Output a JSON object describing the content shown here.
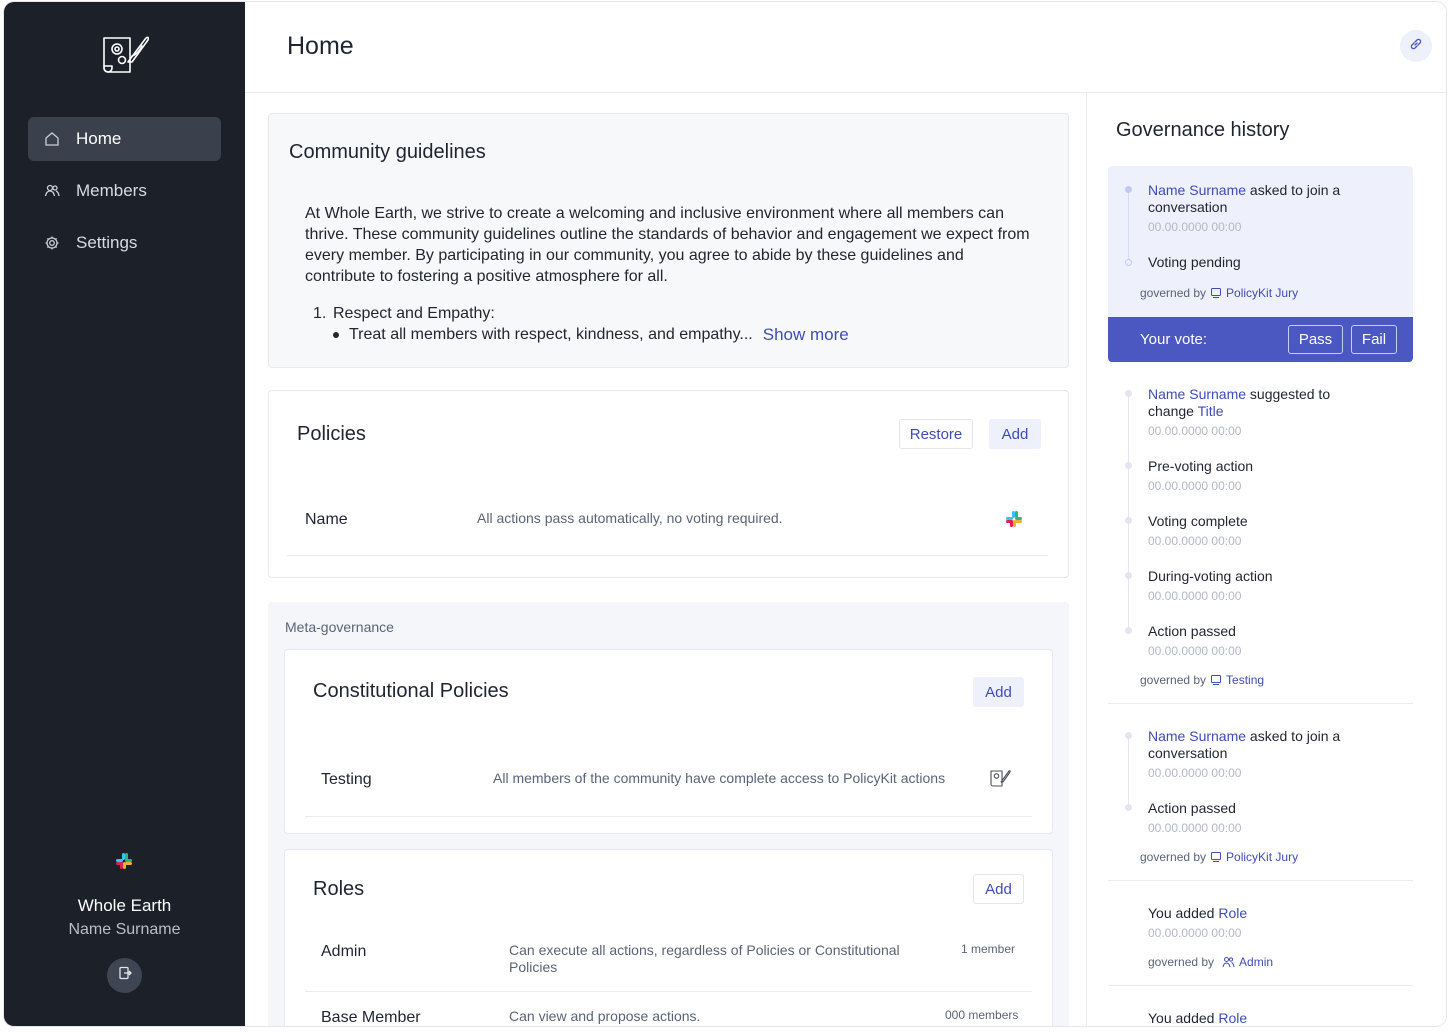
{
  "sidebar": {
    "nav": [
      {
        "label": "Home",
        "icon": "home-icon",
        "active": true
      },
      {
        "label": "Members",
        "icon": "members-icon",
        "active": false
      },
      {
        "label": "Settings",
        "icon": "gear-icon",
        "active": false
      }
    ],
    "org_name": "Whole Earth",
    "user_name": "Name Surname"
  },
  "header": {
    "title": "Home"
  },
  "guidelines": {
    "title": "Community guidelines",
    "body": "At Whole Earth, we strive to create a welcoming and inclusive environment where all members can thrive. These community guidelines outline the standards of behavior and engagement we expect from every member. By participating in our community, you agree to abide by these guidelines and contribute to fostering a positive atmosphere for all.",
    "list_number": "1.",
    "list_item": "Respect and Empathy:",
    "sub_item": "Treat all members with respect, kindness, and empathy...",
    "show_more": "Show more"
  },
  "policies": {
    "title": "Policies",
    "restore_label": "Restore",
    "add_label": "Add",
    "rows": [
      {
        "name": "Name",
        "description": "All actions pass automatically, no voting required.",
        "platform_icon": "slack-icon"
      }
    ]
  },
  "meta": {
    "label": "Meta-governance",
    "constitutional": {
      "title": "Constitutional Policies",
      "add_label": "Add",
      "rows": [
        {
          "name": "Testing",
          "description": "All members of the community have complete access to PolicyKit actions",
          "platform_icon": "policykit-icon"
        }
      ]
    },
    "roles": {
      "title": "Roles",
      "add_label": "Add",
      "rows": [
        {
          "name": "Admin",
          "description": "Can execute all actions, regardless of Policies or Constitutional Policies",
          "count": "1 member"
        },
        {
          "name": "Base Member",
          "description": "Can view and propose actions.",
          "count": "000 members"
        }
      ]
    }
  },
  "history": {
    "title": "Governance history",
    "pending": {
      "actor": "Name Surname",
      "action": " asked to join a conversation",
      "time": "00.00.0000  00:00",
      "status": "Voting pending",
      "governed_by_label": "governed by",
      "governed_by": "PolicyKit Jury",
      "vote_label": "Your vote:",
      "pass_label": "Pass",
      "fail_label": "Fail"
    },
    "second": {
      "actor": "Name Surname",
      "action": " suggested to change ",
      "target": "Title",
      "time": "00.00.0000  00:00",
      "steps": [
        {
          "label": "Pre-voting action",
          "time": "00.00.0000  00:00"
        },
        {
          "label": "Voting complete",
          "time": "00.00.0000  00:00"
        },
        {
          "label": "During-voting action",
          "time": "00.00.0000  00:00"
        },
        {
          "label": "Action passed",
          "time": "00.00.0000  00:00"
        }
      ],
      "governed_by_label": "governed by",
      "governed_by": "Testing"
    },
    "third": {
      "actor": "Name Surname",
      "action": " asked to join a conversation",
      "time": "00.00.0000  00:00",
      "step": "Action passed",
      "step_time": "00.00.0000  00:00",
      "governed_by_label": "governed by",
      "governed_by": "PolicyKit Jury"
    },
    "fourth": {
      "prefix": "You added ",
      "target": "Role",
      "time": "00.00.0000  00:00",
      "governed_by_label": "governed by",
      "governed_by": "Admin"
    },
    "fifth": {
      "prefix": "You added ",
      "target": "Role"
    }
  },
  "colors": {
    "sidebar_bg": "#1c2028",
    "accent": "#4c58c2",
    "link": "#3f4cb5"
  }
}
